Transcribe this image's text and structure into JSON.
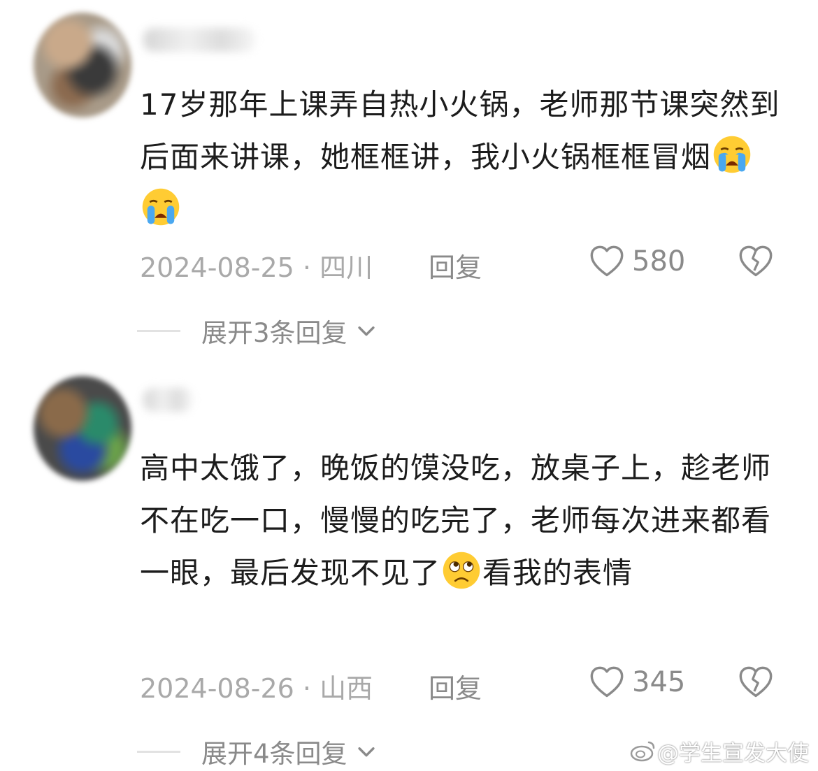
{
  "comments": [
    {
      "text_before_emoji": "17岁那年上课弄自热小火锅，老师那节课突然到后面来讲课，她框框讲，我小火锅框框冒烟",
      "text_after_emoji": "",
      "emoji_name": "loudly-crying-face-emoji",
      "emoji_count": 2,
      "date_location": "2024-08-25 · 四川",
      "reply_label": "回复",
      "like_count": "580",
      "expand_label": "展开3条回复"
    },
    {
      "text_before_emoji": "高中太饿了，晚饭的馍没吃，放桌子上，趁老师不在吃一口，慢慢的吃完了，老师每次进来都看一眼，最后发现不见了",
      "text_after_emoji": "看我的表情",
      "emoji_name": "disappointed-face-emoji",
      "emoji_count": 1,
      "date_location": "2024-08-26 · 山西",
      "reply_label": "回复",
      "like_count": "345",
      "expand_label": "展开4条回复"
    }
  ],
  "watermark": "@学生宣发大使",
  "colors": {
    "text": "#1c1c1c",
    "meta": "#a9a9a9",
    "action": "#8a8a8a"
  }
}
